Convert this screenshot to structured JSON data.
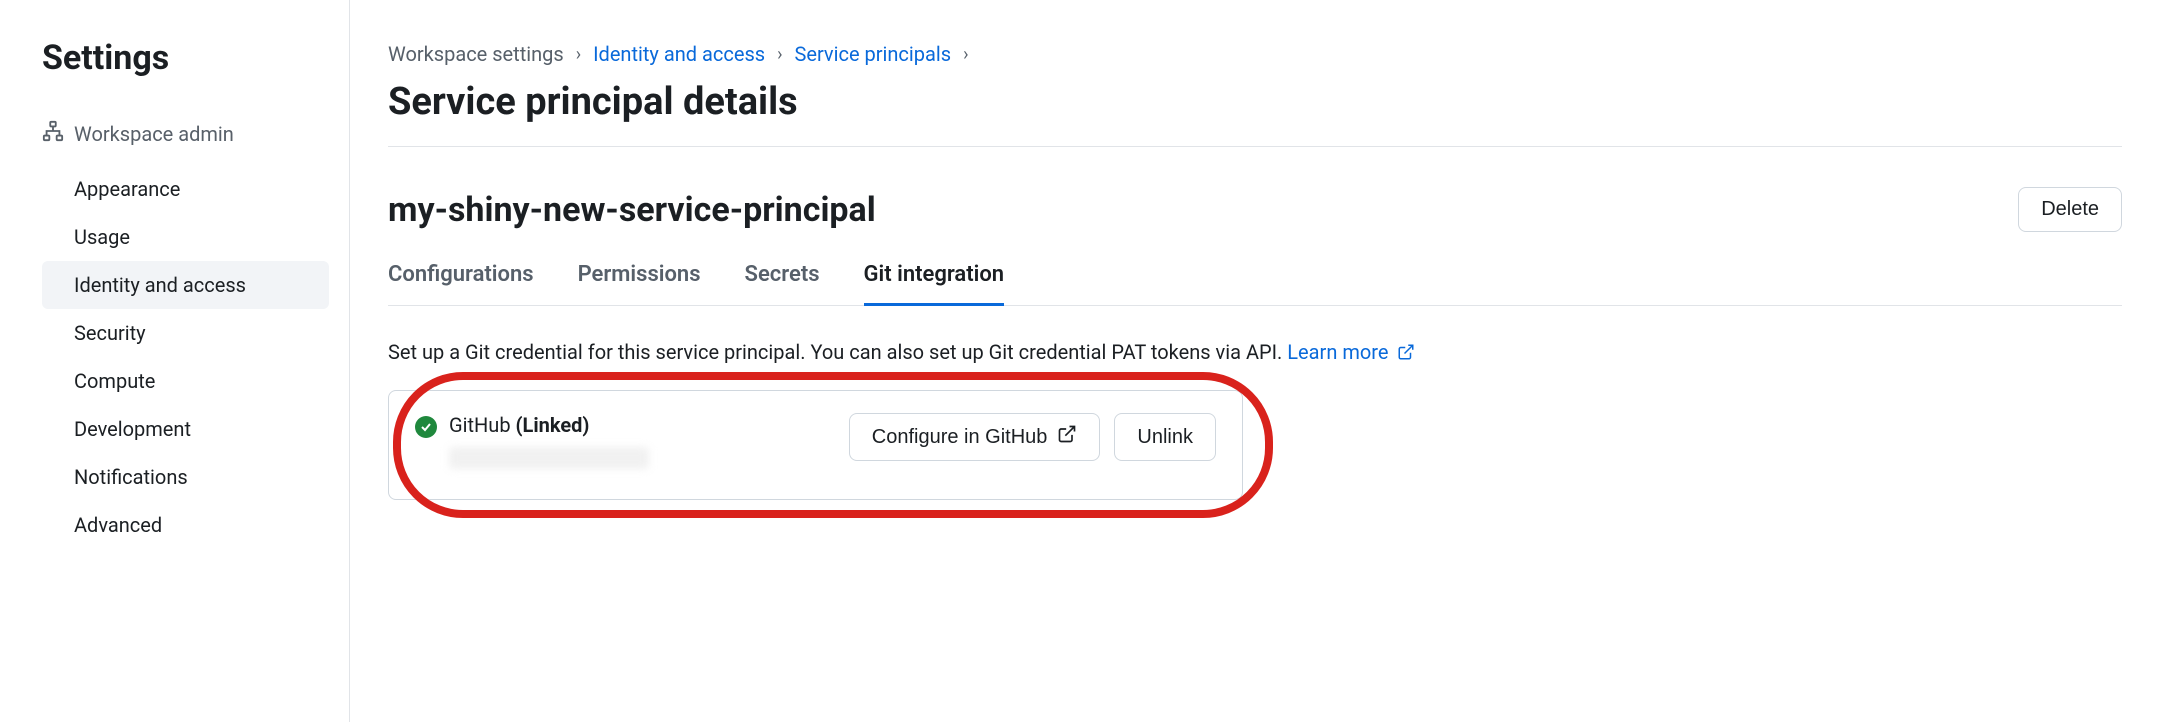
{
  "sidebar": {
    "title": "Settings",
    "section_header": "Workspace admin",
    "items": [
      {
        "label": "Appearance",
        "active": false
      },
      {
        "label": "Usage",
        "active": false
      },
      {
        "label": "Identity and access",
        "active": true
      },
      {
        "label": "Security",
        "active": false
      },
      {
        "label": "Compute",
        "active": false
      },
      {
        "label": "Development",
        "active": false
      },
      {
        "label": "Notifications",
        "active": false
      },
      {
        "label": "Advanced",
        "active": false
      }
    ]
  },
  "breadcrumb": {
    "items": [
      {
        "label": "Workspace settings",
        "link": false
      },
      {
        "label": "Identity and access",
        "link": true
      },
      {
        "label": "Service principals",
        "link": true
      }
    ]
  },
  "page": {
    "title": "Service principal details",
    "principal_name": "my-shiny-new-service-principal",
    "delete_label": "Delete"
  },
  "tabs": [
    {
      "label": "Configurations",
      "active": false
    },
    {
      "label": "Permissions",
      "active": false
    },
    {
      "label": "Secrets",
      "active": false
    },
    {
      "label": "Git integration",
      "active": true
    }
  ],
  "description": {
    "text": "Set up a Git credential for this service principal. You can also set up Git credential PAT tokens via API. ",
    "learn_more": "Learn more"
  },
  "git_card": {
    "provider": "GitHub",
    "status": "(Linked)",
    "configure_label": "Configure in GitHub",
    "unlink_label": "Unlink"
  }
}
